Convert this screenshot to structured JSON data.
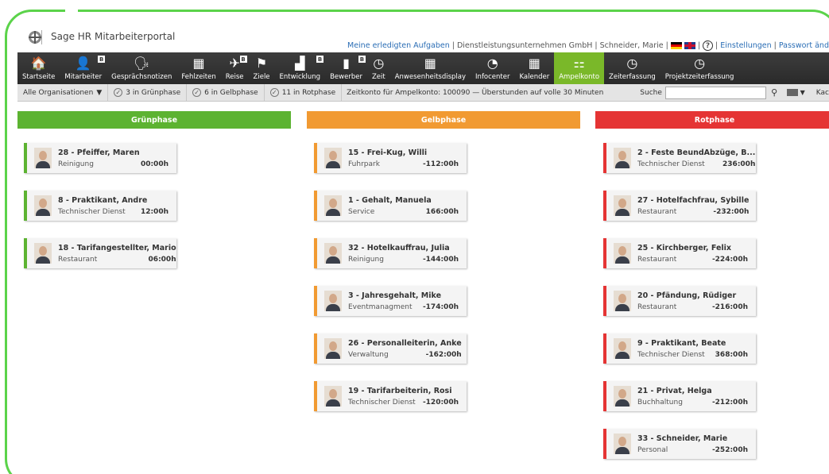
{
  "app": {
    "title": "Sage HR Mitarbeiterportal"
  },
  "toplinks": {
    "tasks": "Meine erledigten Aufgaben",
    "company": "Dienstleistungsunternehmen GmbH",
    "user": "Schneider, Marie",
    "settings": "Einstellungen",
    "password": "Passwort änd"
  },
  "nav": [
    {
      "label": "Startseite",
      "icon": "home-icon",
      "glyph": "🏠"
    },
    {
      "label": "Mitarbeiter",
      "icon": "users-icon",
      "glyph": "👤",
      "badge": "B"
    },
    {
      "label": "Gesprächsnotizen",
      "icon": "profile-icon",
      "glyph": "🗣"
    },
    {
      "label": "Fehlzeiten",
      "icon": "calendar-icon",
      "glyph": "▦"
    },
    {
      "label": "Reise",
      "icon": "plane-icon",
      "glyph": "✈",
      "badge": "B"
    },
    {
      "label": "Ziele",
      "icon": "flag-icon",
      "glyph": "⚑"
    },
    {
      "label": "Entwicklung",
      "icon": "chart-icon",
      "glyph": "▟",
      "badge": "B"
    },
    {
      "label": "Bewerber",
      "icon": "applicant-icon",
      "glyph": "▮",
      "badge": "B"
    },
    {
      "label": "Zeit",
      "icon": "clock-calendar-icon",
      "glyph": "◷"
    },
    {
      "label": "Anwesenheitsdisplay",
      "icon": "grid-icon",
      "glyph": "▦"
    },
    {
      "label": "Infocenter",
      "icon": "pie-icon",
      "glyph": "◔"
    },
    {
      "label": "Kalender",
      "icon": "calendar-icon",
      "glyph": "▦"
    },
    {
      "label": "Ampelkonto",
      "icon": "traffic-light-icon",
      "glyph": "⚏",
      "active": true
    },
    {
      "label": "Zeiterfassung",
      "icon": "time-entry-icon",
      "glyph": "◷"
    },
    {
      "label": "Projektzeiterfassung",
      "icon": "project-time-icon",
      "glyph": "◷"
    }
  ],
  "filter": {
    "org": "Alle Organisationen",
    "green": "3 in Grünphase",
    "yellow": "6 in Gelbphase",
    "red": "11 in Rotphase",
    "info": "Zeitkonto für Ampelkonto: 100090  —  Überstunden auf volle 30 Minuten",
    "search_label": "Suche",
    "search_value": "",
    "kach": "Kac"
  },
  "columns": {
    "green": {
      "title": "Grünphase",
      "cards": [
        {
          "name": "28 - Pfeiffer, Maren",
          "dept": "Reinigung",
          "hours": "00:00h"
        },
        {
          "name": "8 - Praktikant, Andre",
          "dept": "Technischer Dienst",
          "hours": "12:00h"
        },
        {
          "name": "18 - Tarifangestellter, Mario",
          "dept": "Restaurant",
          "hours": "06:00h"
        }
      ]
    },
    "orange": {
      "title": "Gelbphase",
      "cards": [
        {
          "name": "15 - Frei-Kug, Willi",
          "dept": "Fuhrpark",
          "hours": "-112:00h"
        },
        {
          "name": "1 - Gehalt, Manuela",
          "dept": "Service",
          "hours": "166:00h"
        },
        {
          "name": "32 - Hotelkauffrau, Julia",
          "dept": "Reinigung",
          "hours": "-144:00h"
        },
        {
          "name": "3 - Jahresgehalt, Mike",
          "dept": "Eventmanagment",
          "hours": "-174:00h"
        },
        {
          "name": "26 - Personalleiterin, Anke",
          "dept": "Verwaltung",
          "hours": "-162:00h"
        },
        {
          "name": "19 - Tarifarbeiterin, Rosi",
          "dept": "Technischer Dienst",
          "hours": "-120:00h"
        }
      ]
    },
    "red": {
      "title": "Rotphase",
      "cards": [
        {
          "name": "2 - Feste BeundAbzüge, B...",
          "dept": "Technischer Dienst",
          "hours": "236:00h"
        },
        {
          "name": "27 - Hotelfachfrau, Sybille",
          "dept": "Restaurant",
          "hours": "-232:00h"
        },
        {
          "name": "25 - Kirchberger, Felix",
          "dept": "Restaurant",
          "hours": "-224:00h"
        },
        {
          "name": "20 - Pfändung, Rüdiger",
          "dept": "Restaurant",
          "hours": "-216:00h"
        },
        {
          "name": "9 - Praktikant, Beate",
          "dept": "Technischer Dienst",
          "hours": "368:00h"
        },
        {
          "name": "21 - Privat, Helga",
          "dept": "Buchhaltung",
          "hours": "-212:00h"
        },
        {
          "name": "33 - Schneider, Marie",
          "dept": "Personal",
          "hours": "-252:00h"
        }
      ]
    }
  },
  "colors": {
    "green": "#5cb331",
    "orange": "#f19a32",
    "red": "#e53434",
    "accent": "#7ab829",
    "frame": "#5bd34a"
  }
}
